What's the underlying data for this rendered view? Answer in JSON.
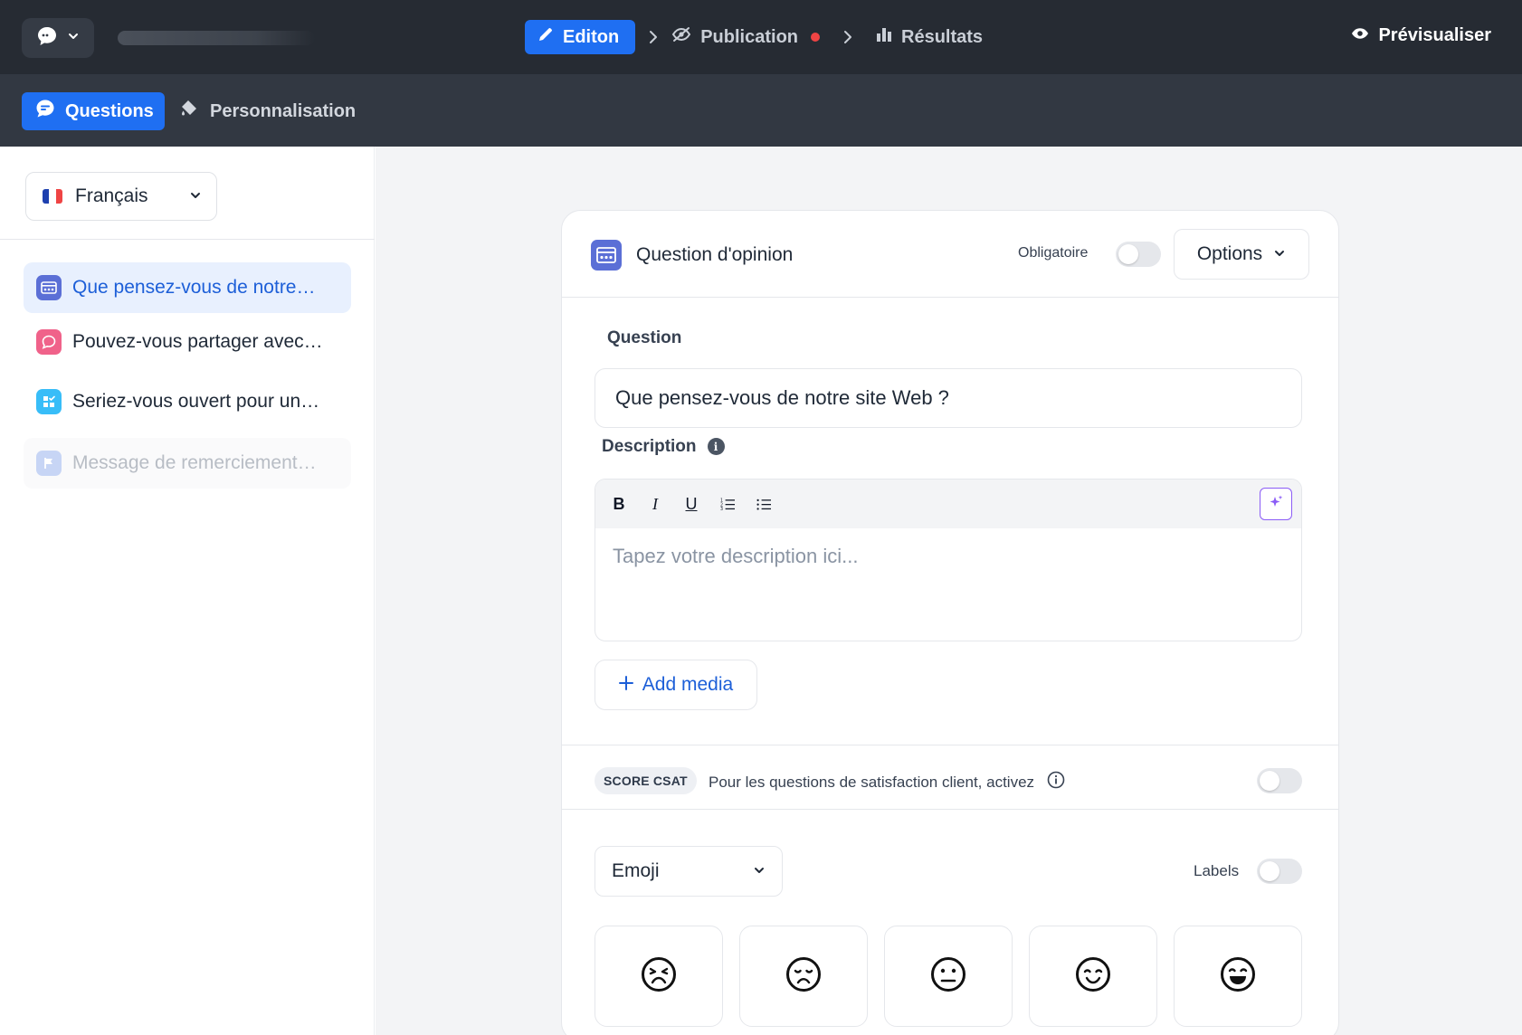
{
  "topbar": {
    "steps": [
      {
        "label": "Editon"
      },
      {
        "label": "Publication"
      },
      {
        "label": "Résultats"
      }
    ],
    "preview_label": "Prévisualiser"
  },
  "subbar": {
    "tabs": [
      {
        "label": "Questions"
      },
      {
        "label": "Personnalisation"
      }
    ]
  },
  "sidebar": {
    "language": "Français",
    "questions": [
      {
        "label": "Que pensez-vous de notre…",
        "icon": "rating-icon",
        "color": "#5b6fd6"
      },
      {
        "label": "Pouvez-vous partager avec…",
        "icon": "chat-bubble-icon",
        "color": "#f0628a"
      },
      {
        "label": "Seriez-vous ouvert pour un…",
        "icon": "checklist-icon",
        "color": "#38bdf8"
      },
      {
        "label": "Message de remerciement…",
        "icon": "flag-icon",
        "color": "#c7d5f5"
      }
    ]
  },
  "card": {
    "title": "Question d'opinion",
    "required_label": "Obligatoire",
    "required_on": false,
    "options_label": "Options",
    "question_label": "Question",
    "question_value": "Que pensez-vous de notre site Web ?",
    "description_label": "Description",
    "description_placeholder": "Tapez votre description ici...",
    "toolbar": [
      "bold",
      "italic",
      "underline",
      "ordered-list",
      "bullet-list"
    ],
    "add_media_label": "Add media",
    "csat_badge": "SCORE CSAT",
    "csat_text": "Pour les questions de satisfaction client, activez",
    "csat_on": false,
    "scale_type": "Emoji",
    "labels_label": "Labels",
    "labels_on": false,
    "emojis": [
      "angry-face-icon",
      "sad-face-icon",
      "neutral-face-icon",
      "smiling-face-icon",
      "laughing-face-icon"
    ]
  },
  "colors": {
    "accent": "#1f6ff2",
    "topbar_bg": "#262b33",
    "subbar_bg": "#323842",
    "status_dot": "#ef4444"
  }
}
